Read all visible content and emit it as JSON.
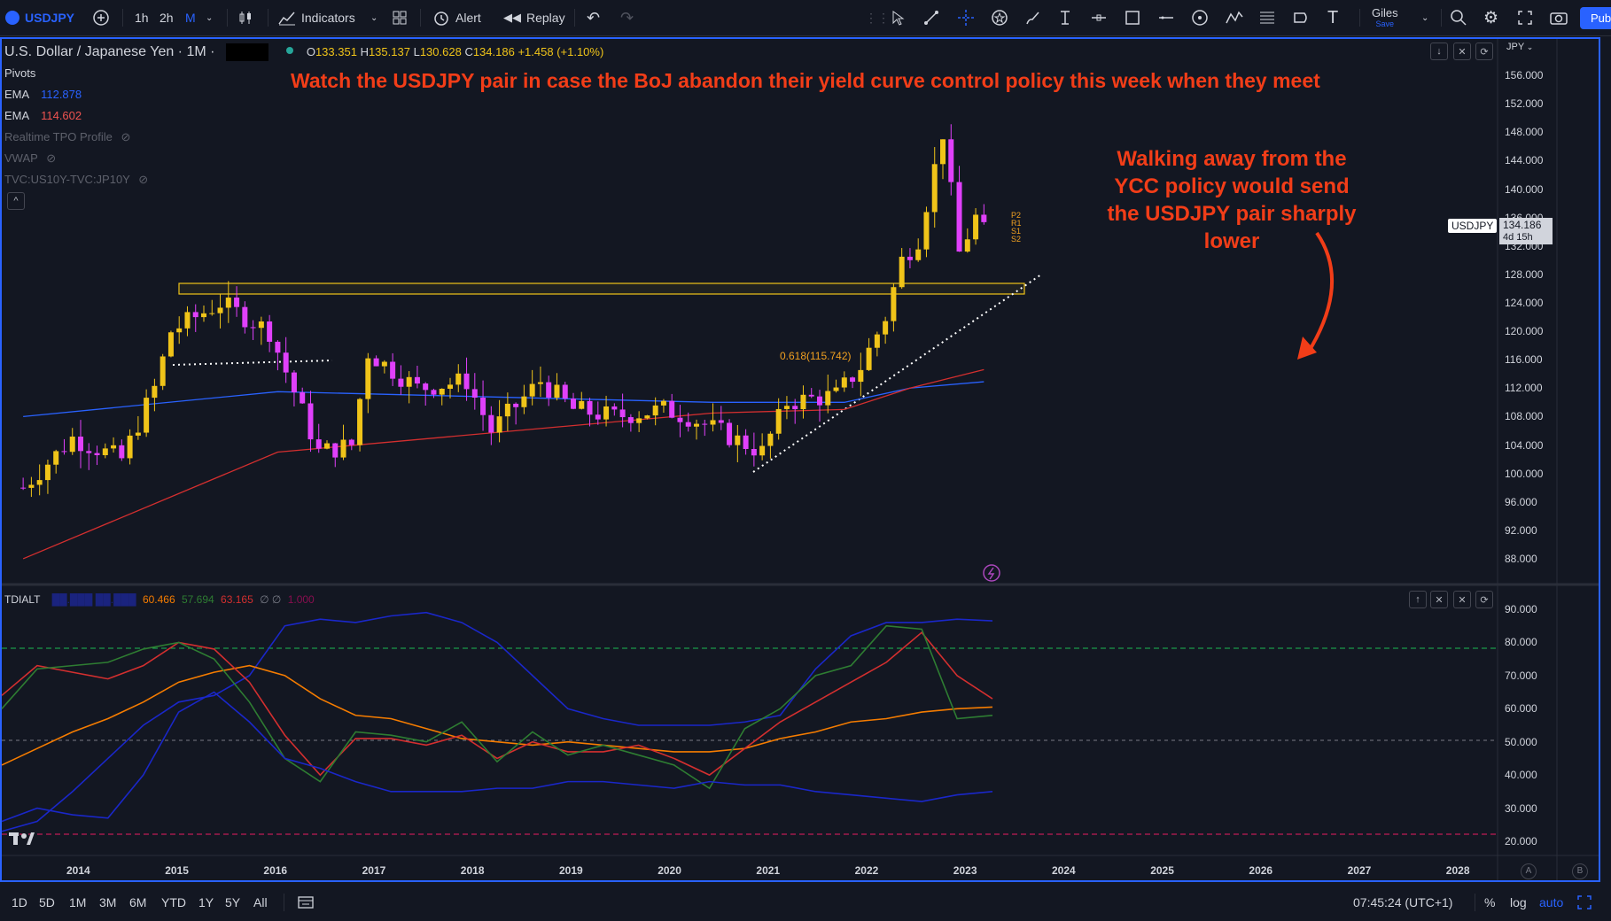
{
  "toolbar": {
    "symbol": "USDJPY",
    "intervals": [
      "1h",
      "2h",
      "M"
    ],
    "indicators_label": "Indicators",
    "alert_label": "Alert",
    "replay_label": "Replay",
    "layout_name": "Giles",
    "layout_status": "Save",
    "publish_label": "Pub"
  },
  "legend": {
    "title": "U.S. Dollar / Japanese Yen · 1M ·",
    "ohlc_o_label": "O",
    "ohlc_o": "133.351",
    "ohlc_h_label": "H",
    "ohlc_h": "135.137",
    "ohlc_l_label": "L",
    "ohlc_l": "130.628",
    "ohlc_c_label": "C",
    "ohlc_c": "134.186",
    "ohlc_change": "+1.458 (+1.10%)",
    "pivots": "Pivots",
    "ema1_label": "EMA",
    "ema1_value": "112.878",
    "ema2_label": "EMA",
    "ema2_value": "114.602",
    "tpo": "Realtime TPO Profile",
    "vwap": "VWAP",
    "spread": "TVC:US10Y-TVC:JP10Y",
    "collapse": "^"
  },
  "annotations": {
    "headline": "Watch the USDJPY pair in case the BoJ abandon their yield curve control policy this week when they meet",
    "side_lines": [
      "Walking away from the",
      "YCC policy would send",
      "the USDJPY pair sharply",
      "lower"
    ],
    "fib_label": "0.618(115.742)"
  },
  "price_axis": {
    "currency": "JPY",
    "ticks": [
      "156.000",
      "152.000",
      "148.000",
      "144.000",
      "140.000",
      "136.000",
      "132.000",
      "128.000",
      "124.000",
      "120.000",
      "116.000",
      "112.000",
      "108.000",
      "104.000",
      "100.000",
      "96.000",
      "92.000",
      "88.000"
    ],
    "last_symbol": "USDJPY",
    "last_price": "134.186",
    "countdown": "4d 15h"
  },
  "indicator": {
    "name": "TDIALT",
    "values": [
      "60.466",
      "57.694",
      "63.165"
    ],
    "extra": "1.000",
    "ticks": [
      "90.000",
      "80.000",
      "70.000",
      "60.000",
      "50.000",
      "40.000",
      "30.000",
      "20.000"
    ]
  },
  "time_axis": {
    "years": [
      "2014",
      "2015",
      "2016",
      "2017",
      "2018",
      "2019",
      "2020",
      "2021",
      "2022",
      "2023",
      "2024",
      "2025",
      "2026",
      "2027",
      "2028"
    ],
    "corner_a": "A",
    "corner_b": "B"
  },
  "bottom": {
    "ranges": [
      "1D",
      "5D",
      "1M",
      "3M",
      "6M",
      "YTD",
      "1Y",
      "5Y",
      "All"
    ],
    "clock": "07:45:24 (UTC+1)",
    "percent": "%",
    "log": "log",
    "auto": "auto"
  },
  "colors": {
    "background": "#131722",
    "up_candle": "#f0c419",
    "down_candle": "#e040fb",
    "ema_fast": "#2962ff",
    "ema_slow": "#d32f2f",
    "annotation_red": "#f23d18",
    "accent_blue": "#2962ff"
  },
  "chart_data": {
    "type": "candlestick",
    "timeframe": "1M",
    "y_range": [
      86,
      158
    ],
    "x_range": [
      "2013-06",
      "2028-08"
    ],
    "close_path": [
      [
        "2013-06",
        98
      ],
      [
        "2013-12",
        105
      ],
      [
        "2014-06",
        102
      ],
      [
        "2014-10",
        112
      ],
      [
        "2014-12",
        120
      ],
      [
        "2015-06",
        124
      ],
      [
        "2015-12",
        120
      ],
      [
        "2016-06",
        103
      ],
      [
        "2016-10",
        104
      ],
      [
        "2016-12",
        117
      ],
      [
        "2017-06",
        112
      ],
      [
        "2017-12",
        113
      ],
      [
        "2018-03",
        106
      ],
      [
        "2018-09",
        113
      ],
      [
        "2019-01",
        109
      ],
      [
        "2019-06",
        108
      ],
      [
        "2019-12",
        109
      ],
      [
        "2020-03",
        108
      ],
      [
        "2020-12",
        103
      ],
      [
        "2021-03",
        110
      ],
      [
        "2021-09",
        111
      ],
      [
        "2021-12",
        115
      ],
      [
        "2022-03",
        122
      ],
      [
        "2022-05",
        130
      ],
      [
        "2022-07",
        133
      ],
      [
        "2022-10",
        148
      ],
      [
        "2022-12",
        131
      ],
      [
        "2023-02",
        136
      ],
      [
        "2023-03",
        134
      ]
    ],
    "resistance_zone": [
      125.5,
      127
    ],
    "fib_level": 115.742,
    "ema_fast_path": [
      [
        "2013-06",
        108
      ],
      [
        "2016-01",
        111.5
      ],
      [
        "2020-06",
        110
      ],
      [
        "2021-10",
        110
      ],
      [
        "2022-06",
        112
      ],
      [
        "2023-03",
        112.9
      ]
    ],
    "ema_slow_path": [
      [
        "2013-06",
        88
      ],
      [
        "2016-01",
        103
      ],
      [
        "2020-06",
        108.5
      ],
      [
        "2021-10",
        109
      ],
      [
        "2022-06",
        112
      ],
      [
        "2023-03",
        114.6
      ]
    ]
  }
}
